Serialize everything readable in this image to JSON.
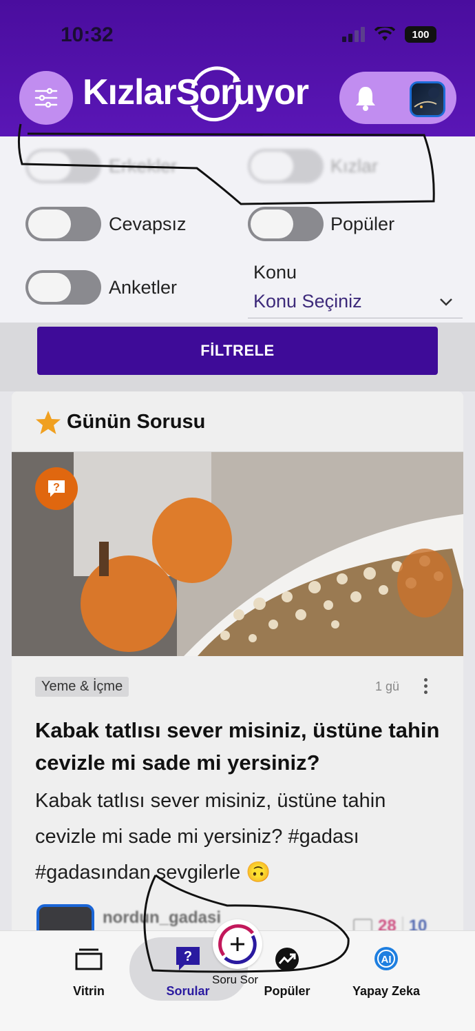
{
  "status_bar": {
    "time": "10:32",
    "battery": "100"
  },
  "header": {
    "logo_text": "KızlarSoruyor"
  },
  "filters": {
    "toggles": [
      {
        "label": "Erkekler"
      },
      {
        "label": "Kızlar"
      },
      {
        "label": "Cevapsız"
      },
      {
        "label": "Popüler"
      },
      {
        "label": "Anketler"
      }
    ],
    "konu_label": "Konu",
    "konu_value": "Konu Seçiniz",
    "filter_button": "FİLTRELE"
  },
  "card": {
    "section_title": "Günün Sorusu",
    "tag": "Yeme & İçme",
    "time_ago": "1 gü",
    "question_title": "Kabak tatlısı sever misiniz, üstüne tahin cevizle mi sade mi yersiniz?",
    "question_body": "Kabak tatlısı sever misiniz, üstüne tahin cevizle mi sade mi yersiniz? #gadası #gadasından sevgilerle 🙃",
    "author": "nordun_gadasi",
    "stat_red": "28",
    "stat_blue": "10"
  },
  "nav": {
    "items": [
      {
        "label": "Vitrin"
      },
      {
        "label": "Sorular"
      },
      {
        "label": "Soru Sor"
      },
      {
        "label": "Popüler"
      },
      {
        "label": "Yapay Zeka"
      }
    ],
    "active_color": "#2a1aa0"
  },
  "colors": {
    "header": "#4a0d9e",
    "pill": "#c18df0",
    "button": "#3e0b98",
    "badge": "#e0670f"
  }
}
